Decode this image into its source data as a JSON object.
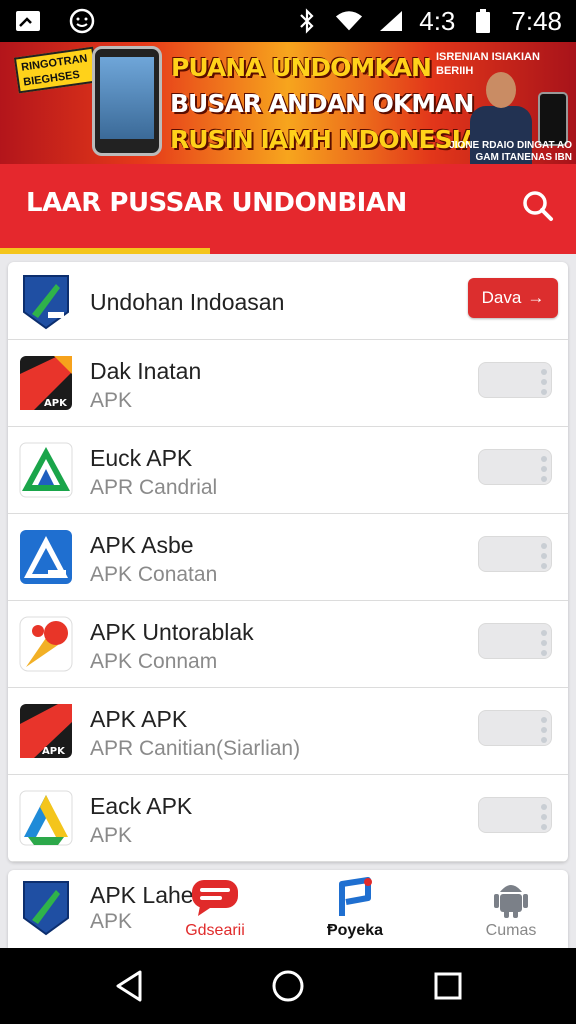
{
  "status_bar": {
    "notification_icons": [
      "cast-icon",
      "smiley-icon"
    ],
    "system_icons": [
      "bluetooth-icon",
      "wifi-icon",
      "signal-icon",
      "battery-icon"
    ],
    "battery_text": "4:3",
    "time": "7:48"
  },
  "banner": {
    "line1": "PUANA UNDOMKAN",
    "line2": "BUSAR ANDAN OKMAN",
    "line3": "RUSIN IAMH NDONESIA",
    "tag_left": "RINGOTRAN BIEGHSES",
    "right_top": "ISRENIAN ISIAKIAN BERIIH",
    "right_bottom_left": "JIONE RDAIO",
    "right_bottom_right": "DINGAT AO GAM ITANENAS IBN"
  },
  "header": {
    "title": "LAAR PUSSAR UNDONBIAN",
    "search_icon": "search-icon"
  },
  "apps": [
    {
      "name": "Undohan Indoasan",
      "sub": "",
      "action": "button",
      "button_label": "Dava",
      "icon": "blue-shield-app-icon"
    },
    {
      "name": "Dak Inatan",
      "sub": "APK",
      "action": "toggle",
      "icon": "red-black-apk-icon"
    },
    {
      "name": "Euck APK",
      "sub": "APR Candrial",
      "action": "toggle",
      "icon": "green-triangle-app-icon"
    },
    {
      "name": "APK Asbe",
      "sub": "APK Conatan",
      "action": "toggle",
      "icon": "blue-triangle-app-icon"
    },
    {
      "name": "APK Untorablak",
      "sub": "APK Connam",
      "action": "toggle",
      "icon": "cone-app-icon"
    },
    {
      "name": "APK APK",
      "sub": "APR Canitian(Siarlian)",
      "action": "toggle",
      "icon": "red-black-apk-icon"
    },
    {
      "name": "Eack APK",
      "sub": "APK",
      "action": "toggle",
      "icon": "green-yellow-triangle-icon"
    }
  ],
  "partial_app": {
    "name": "APK Lahe",
    "sub": "APK",
    "icon": "blue-shield-app-icon"
  },
  "bottom_nav": [
    {
      "label": "Gdsearii",
      "icon": "chat-bubble-icon",
      "color": "#e02a2a"
    },
    {
      "label": "Ᵽoyeka",
      "icon": "flag-p-icon",
      "color": "#111111"
    },
    {
      "label": "Cumas",
      "icon": "android-icon",
      "color": "#888888"
    }
  ],
  "system_nav": [
    "back-icon",
    "home-icon",
    "recents-icon"
  ],
  "colors": {
    "primary": "#e5282d",
    "accent": "#f4c51c",
    "banner_yellow": "#ffd21a"
  }
}
